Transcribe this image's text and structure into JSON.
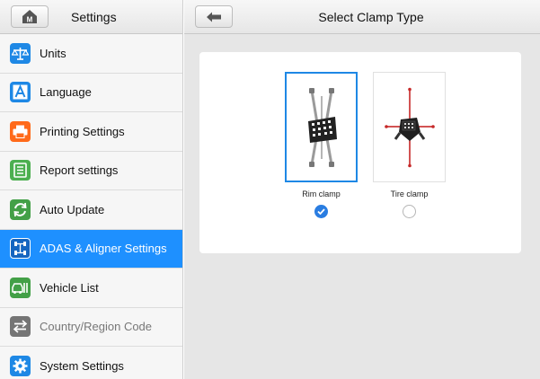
{
  "sidebar": {
    "title": "Settings",
    "home_icon": "m-home-icon",
    "items": [
      {
        "label": "Units",
        "icon": "scale-icon",
        "color": "#1e88e5",
        "active": false,
        "disabled": false
      },
      {
        "label": "Language",
        "icon": "letter-a-icon",
        "color": "#1e88e5",
        "active": false,
        "disabled": false
      },
      {
        "label": "Printing Settings",
        "icon": "printer-icon",
        "color": "#ff6a1a",
        "active": false,
        "disabled": false
      },
      {
        "label": "Report settings",
        "icon": "report-icon",
        "color": "#4caf50",
        "active": false,
        "disabled": false
      },
      {
        "label": "Auto Update",
        "icon": "update-arrows-icon",
        "color": "#43a047",
        "active": true,
        "disabled": false
      },
      {
        "label": "ADAS & Aligner Settings",
        "icon": "adas-icon",
        "color": "#1565c0",
        "active": true,
        "disabled": false
      },
      {
        "label": "Vehicle List",
        "icon": "vehicle-list-icon",
        "color": "#43a047",
        "active": false,
        "disabled": false
      },
      {
        "label": "Country/Region Code",
        "icon": "swap-arrows-icon",
        "color": "#757575",
        "active": false,
        "disabled": true
      },
      {
        "label": "System Settings",
        "icon": "gear-icon",
        "color": "#1e88e5",
        "active": false,
        "disabled": false
      }
    ]
  },
  "main": {
    "title": "Select Clamp Type",
    "back_icon": "back-arrow-icon",
    "options": [
      {
        "label": "Rim clamp",
        "selected": true
      },
      {
        "label": "Tire clamp",
        "selected": false
      }
    ]
  },
  "colors": {
    "accent": "#1e90ff",
    "selected_border": "#1e88e5"
  }
}
